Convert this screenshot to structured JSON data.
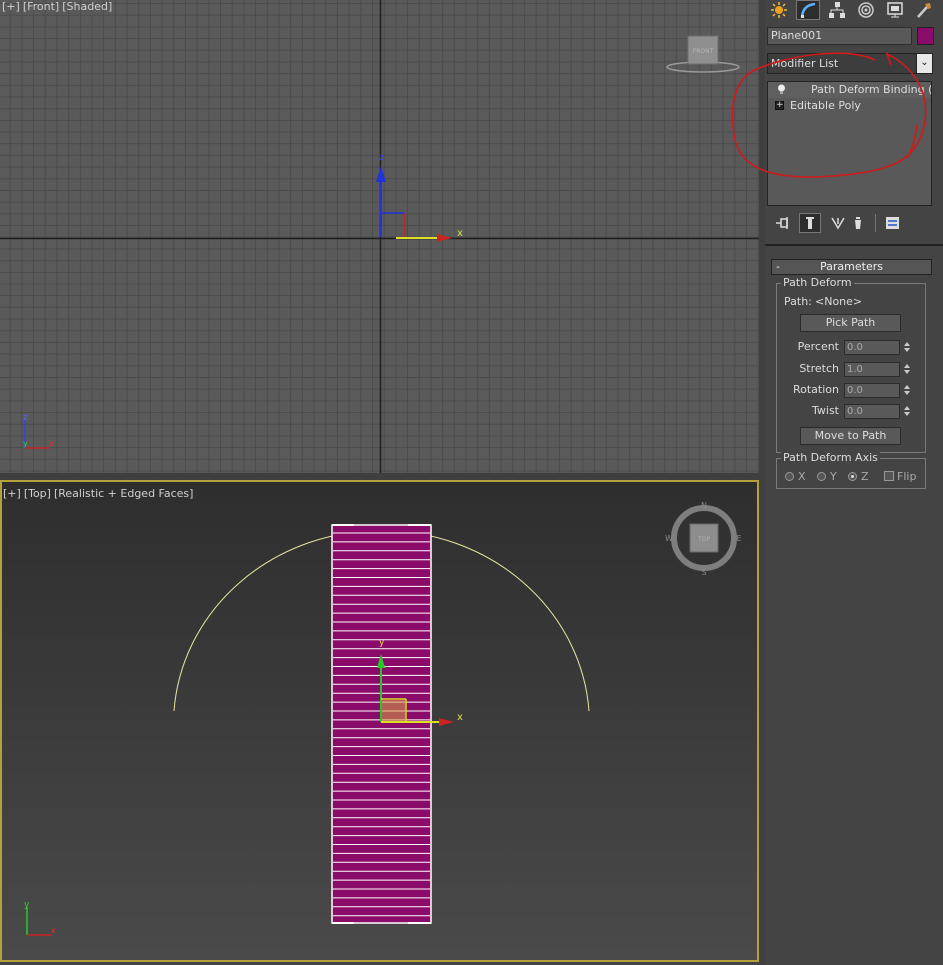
{
  "viewport_front": {
    "label_plus": "[+]",
    "label_view": "[Front]",
    "label_shade": "[Shaded]",
    "viewcube_label": "FRONT",
    "gizmo_z": "z",
    "gizmo_x": "x",
    "axis_z": "z",
    "axis_y": "y",
    "axis_x": "x"
  },
  "viewport_top": {
    "label_plus": "[+]",
    "label_view": "[Top]",
    "label_shade": "[Realistic + Edged Faces]",
    "viewcube_label": "TOP",
    "compass_n": "N",
    "compass_s": "S",
    "compass_e": "E",
    "compass_w": "W",
    "gizmo_y": "y",
    "gizmo_x": "x",
    "axis_y": "y",
    "axis_x": "x",
    "plane_color": "#8b0b6a",
    "path_color": "#e8e6a0"
  },
  "command_panel": {
    "tabs": [
      "create-icon",
      "modify-icon",
      "hierarchy-icon",
      "motion-icon",
      "display-icon",
      "utilities-icon"
    ],
    "object_name": "Plane001",
    "object_color": "#8b0b6a",
    "modifier_list": "Modifier List",
    "stack": [
      {
        "label": "Path Deform Binding (WS",
        "selected": true
      },
      {
        "label": "Editable Poly",
        "selected": false
      }
    ],
    "stack_tools": [
      "pin-stack-icon",
      "show-end-result-icon",
      "make-unique-icon",
      "remove-modifier-icon",
      "configure-sets-icon"
    ],
    "parameters": {
      "title": "Parameters",
      "collapse": "-",
      "path_deform_group": "Path Deform",
      "path_label": "Path:",
      "path_value": "<None>",
      "pick_path": "Pick Path",
      "percent_label": "Percent",
      "percent_value": "0.0",
      "stretch_label": "Stretch",
      "stretch_value": "1.0",
      "rotation_label": "Rotation",
      "rotation_value": "0.0",
      "twist_label": "Twist",
      "twist_value": "0.0",
      "move_to_path": "Move to Path",
      "axis_group": "Path Deform Axis",
      "axis_x": "X",
      "axis_y": "Y",
      "axis_z": "Z",
      "flip": "Flip"
    }
  },
  "annotation_color": "#d11a1a"
}
